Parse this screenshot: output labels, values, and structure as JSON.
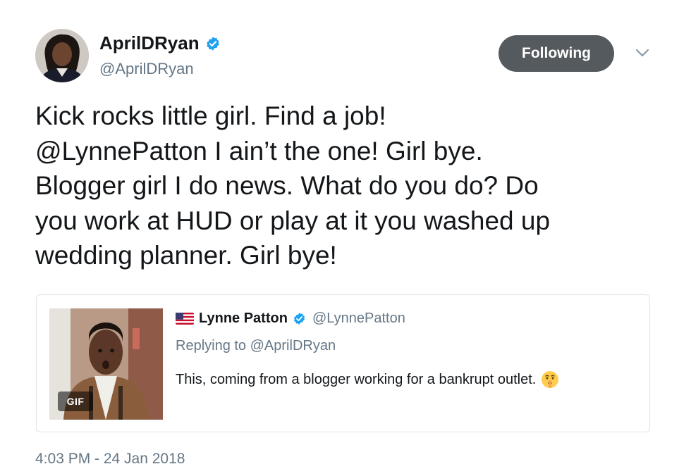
{
  "author": {
    "display_name": "AprilDRyan",
    "handle": "@AprilDRyan",
    "verified": true,
    "verified_color": "#1da1f2"
  },
  "actions": {
    "follow_label": "Following",
    "follow_color": "#555a5e"
  },
  "tweet": {
    "lines": [
      "Kick rocks little girl. Find a job!",
      "@LynnePatton  I ain’t the one! Girl bye.",
      "Blogger girl I do news. What do you do? Do",
      "you work at HUD or play at it you washed up",
      "wedding planner. Girl bye!"
    ],
    "timestamp": "4:03 PM - 24 Jan 2018"
  },
  "quoted_tweet": {
    "media_badge": "GIF",
    "display_name": "Lynne Patton",
    "handle": "@LynnePatton",
    "verified": true,
    "replying_prefix": "Replying to",
    "replying_to": "@AprilDRyan",
    "text": "This, coming from a blogger working for a bankrupt outlet.",
    "flag_icon": "us-flag-icon",
    "emoji_icon": "shushing-face-icon"
  }
}
